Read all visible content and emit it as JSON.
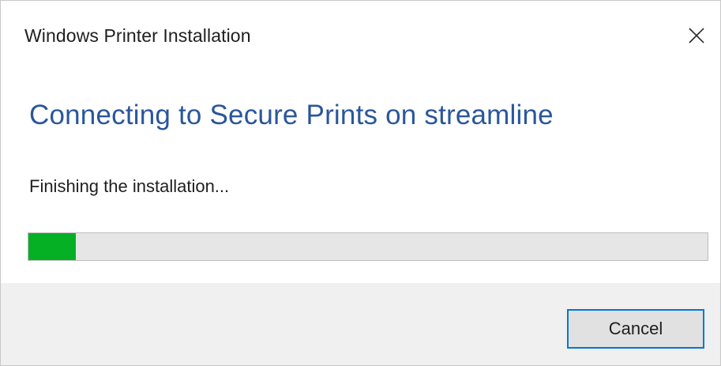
{
  "window": {
    "title": "Windows Printer Installation",
    "close_icon": "close-icon"
  },
  "main": {
    "heading": "Connecting to Secure Prints on streamline",
    "status": "Finishing the installation...",
    "progress_fraction": 0.07,
    "progress_color": "#06b025",
    "heading_color": "#2b579a"
  },
  "footer": {
    "cancel_label": "Cancel",
    "accent_color": "#0078d7"
  }
}
